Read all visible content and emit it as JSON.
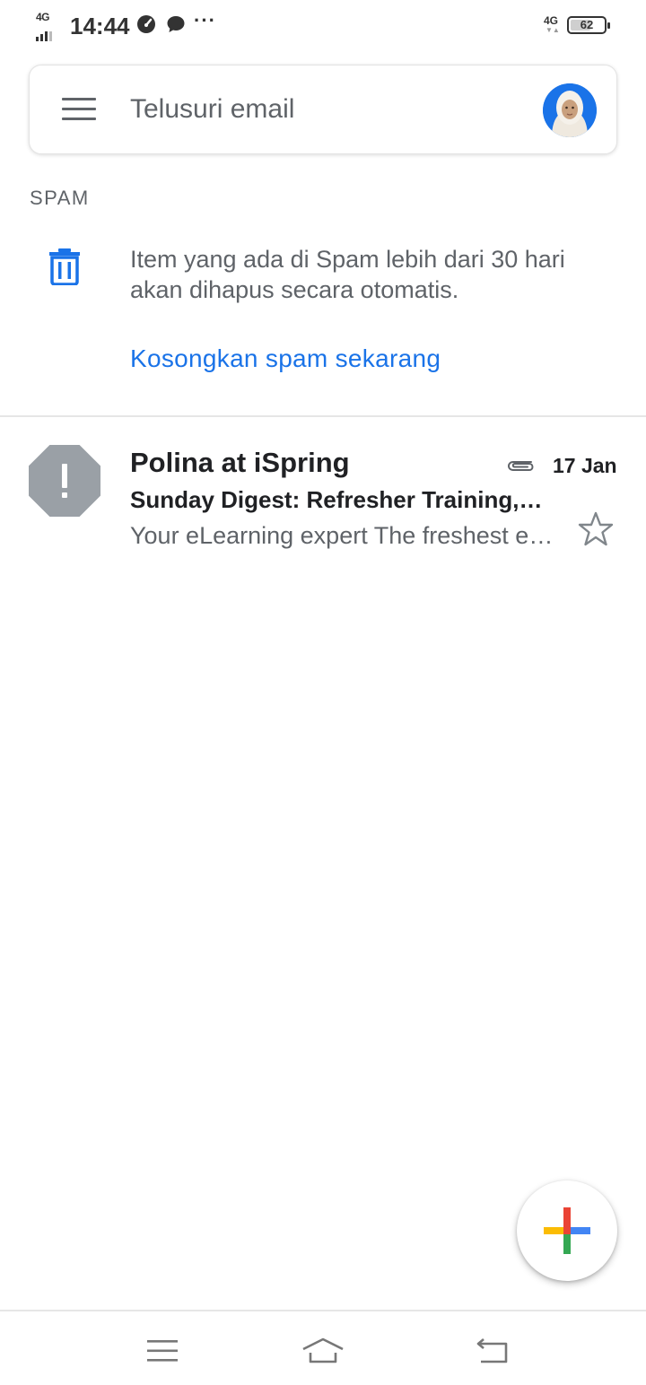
{
  "status_bar": {
    "network_left": "4G",
    "time": "14:44",
    "more_indicator": "···",
    "network_right": "4G",
    "battery_level": "62",
    "icons": [
      "signal-icon",
      "speed-icon",
      "chat-bubble-icon",
      "battery-icon"
    ]
  },
  "search": {
    "placeholder": "Telusuri email",
    "menu_icon": "hamburger-menu-icon",
    "avatar_icon": "account-avatar"
  },
  "spam": {
    "label": "SPAM",
    "info": "Item yang ada di Spam lebih dari 30 hari akan dihapus secara otomatis.",
    "empty_action": "Kosongkan spam sekarang",
    "icon": "trash-icon"
  },
  "emails": [
    {
      "sender": "Polina at iSpring",
      "date": "17 Jan",
      "subject": "Sunday Digest: Refresher Training, New Articles and More",
      "snippet": "Your eLearning expert The freshest eLearning news",
      "has_attachment": true,
      "starred": false,
      "icon": "spam-warning-icon"
    }
  ],
  "fab": {
    "icon": "compose-plus-icon"
  },
  "nav_bar": {
    "icons": [
      "recent-apps-icon",
      "home-icon",
      "back-icon"
    ]
  },
  "colors": {
    "accent_blue": "#1a73e8",
    "text_primary": "#202124",
    "text_secondary": "#5f6368",
    "warning_gray": "#9aa0a6",
    "google_red": "#ea4335",
    "google_blue": "#4285f4",
    "google_green": "#34a853",
    "google_yellow": "#fbbc04"
  }
}
